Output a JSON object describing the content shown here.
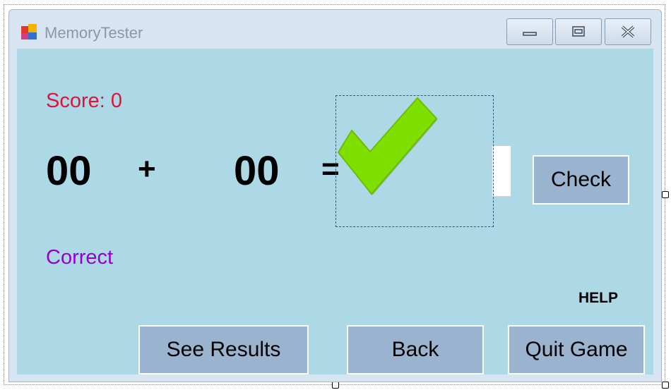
{
  "window": {
    "title": "MemoryTester",
    "buttons": {
      "minimize": "minimize-icon",
      "maximize": "maximize-icon",
      "close": "close-icon"
    }
  },
  "game": {
    "score_label": "Score: 0",
    "operand1": "00",
    "operator": "+",
    "operand2": "00",
    "equals": "=",
    "answer_value": "",
    "check_label": "Check",
    "result_text": "Correct",
    "help_label": "HELP",
    "status_icon": "checkmark-icon"
  },
  "bottom_buttons": {
    "see_results": "See Results",
    "back": "Back",
    "quit": "Quit Game"
  },
  "colors": {
    "client_background": "#add8e6",
    "score": "#dc143c",
    "result": "#9400d3",
    "button": "#9ab3cf",
    "checkmark": "#7fe000"
  }
}
